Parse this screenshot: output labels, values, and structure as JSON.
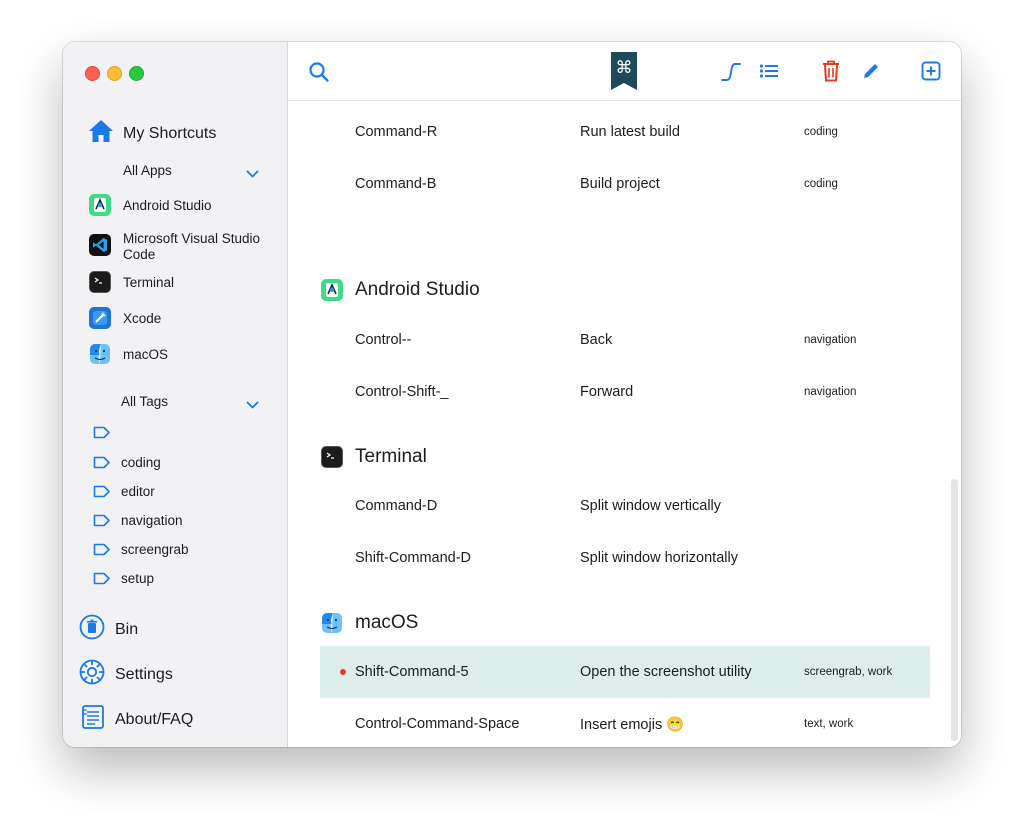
{
  "sidebar": {
    "my_shortcuts": "My Shortcuts",
    "all_apps": "All Apps",
    "apps": [
      {
        "name": "Android Studio",
        "icon": "android-studio-icon"
      },
      {
        "name": "Microsoft Visual Studio Code",
        "icon": "vscode-icon"
      },
      {
        "name": "Terminal",
        "icon": "terminal-icon"
      },
      {
        "name": "Xcode",
        "icon": "xcode-icon"
      },
      {
        "name": "macOS",
        "icon": "finder-icon"
      }
    ],
    "all_tags": "All Tags",
    "tags": [
      "",
      "coding",
      "editor",
      "navigation",
      "screengrab",
      "setup"
    ],
    "bin": "Bin",
    "settings": "Settings",
    "about": "About/FAQ"
  },
  "toolbar": {
    "logo_glyph": "⌘",
    "icons": [
      "search-icon",
      "curve-icon",
      "list-icon",
      "trash-icon",
      "pencil-icon",
      "add-icon"
    ]
  },
  "colors": {
    "accent": "#1a7ae8",
    "danger": "#e8361f",
    "selected_row": "#dcedec",
    "logo": "#1e4b5c"
  },
  "content": {
    "top_rows": [
      {
        "keys": "Command-R",
        "description": "Run latest build",
        "tags": "coding"
      },
      {
        "keys": "Command-B",
        "description": "Build project",
        "tags": "coding"
      }
    ],
    "sections": [
      {
        "title": "Android Studio",
        "rows": [
          {
            "keys": "Control--",
            "description": "Back",
            "tags": "navigation"
          },
          {
            "keys": "Control-Shift-_",
            "description": "Forward",
            "tags": "navigation"
          }
        ]
      },
      {
        "title": "Terminal",
        "rows": [
          {
            "keys": "Command-D",
            "description": "Split window vertically",
            "tags": ""
          },
          {
            "keys": "Shift-Command-D",
            "description": "Split window horizontally",
            "tags": ""
          }
        ]
      },
      {
        "title": "macOS",
        "rows": [
          {
            "keys": "Shift-Command-5",
            "description": "Open the screenshot utility",
            "tags": "screengrab, work"
          },
          {
            "keys": "Control-Command-Space",
            "description": "Insert emojis 😁",
            "tags": "text, work"
          }
        ]
      }
    ]
  }
}
